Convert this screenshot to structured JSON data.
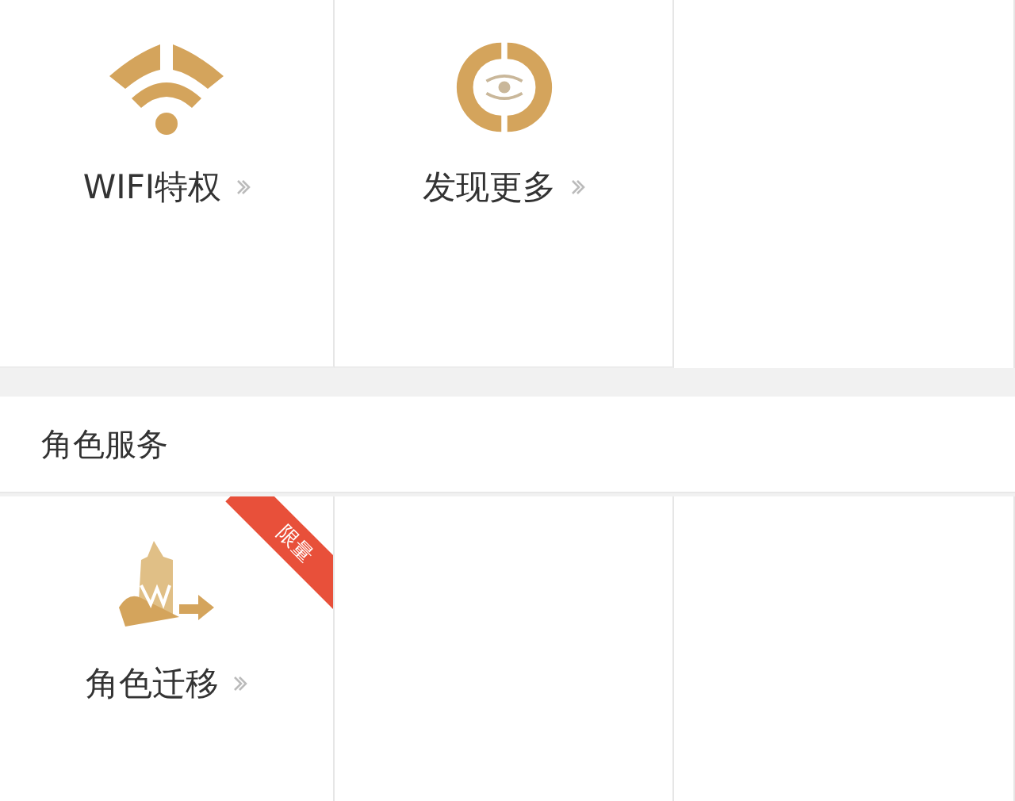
{
  "sections": [
    {
      "items": [
        {
          "label": "WIFI特权",
          "kind": "wifi"
        },
        {
          "label": "发现更多",
          "kind": "eye"
        }
      ]
    },
    {
      "title": "角色服务",
      "items": [
        {
          "label": "角色迁移",
          "kind": "character",
          "badge": "限量"
        }
      ]
    }
  ]
}
